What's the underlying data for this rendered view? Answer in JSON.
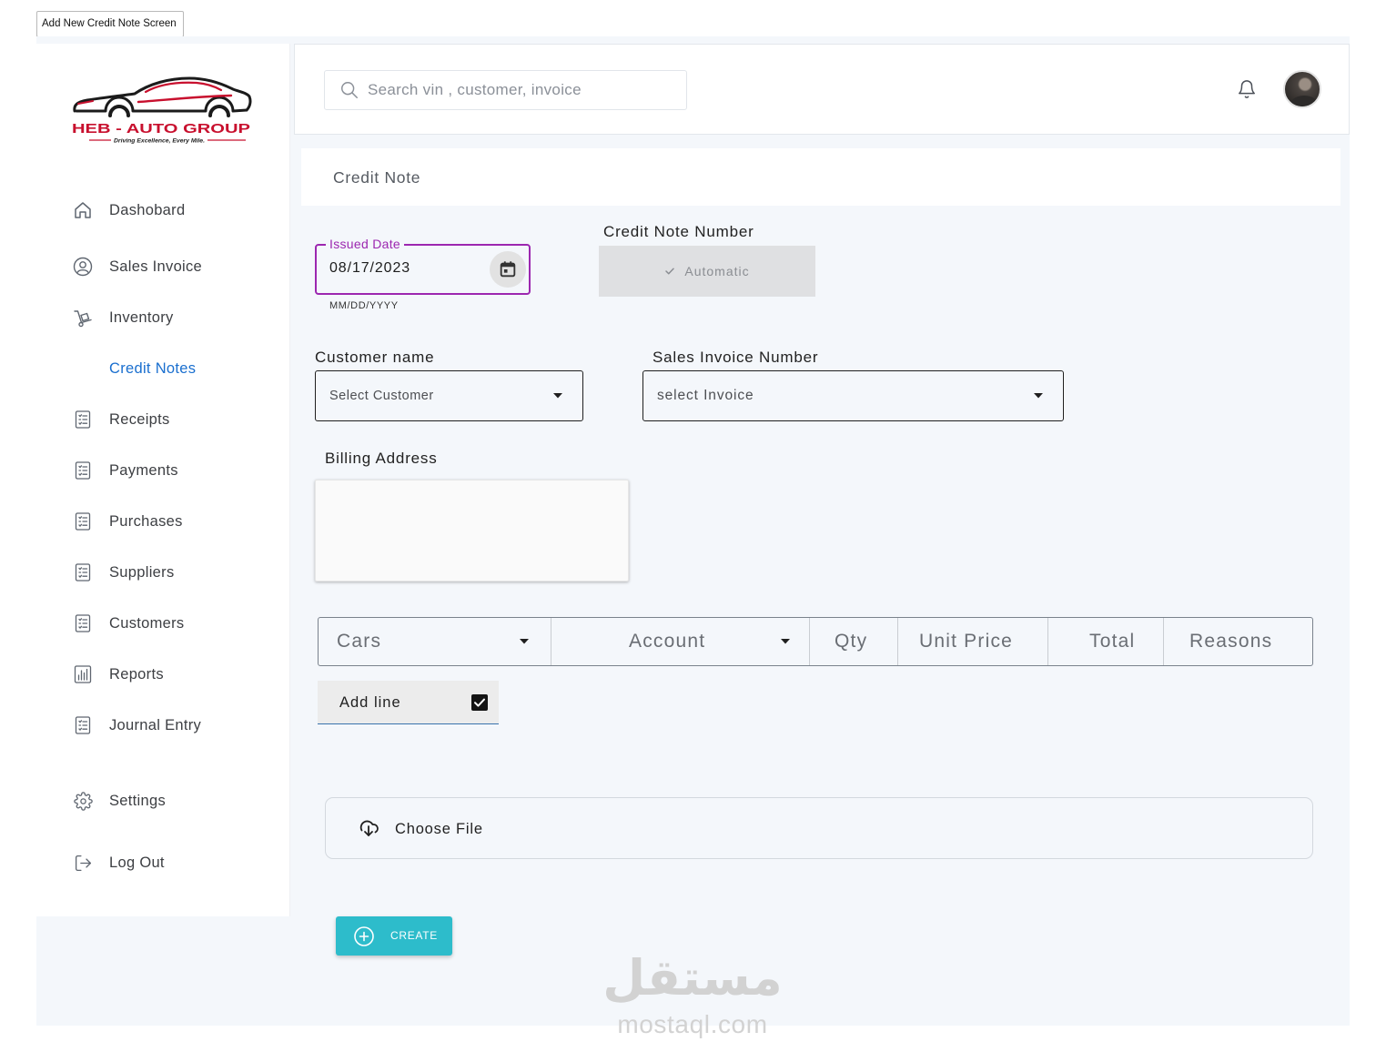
{
  "screen_label": "Add New Credit Note Screen",
  "logo": {
    "brand": "HEB - AUTO GROUP",
    "tagline": "Driving Excellence, Every Mile."
  },
  "sidebar": {
    "items": [
      {
        "label": "Dashobard",
        "icon": "home-icon"
      },
      {
        "label": "Sales Invoice",
        "icon": "user-circle-icon"
      },
      {
        "label": "Inventory",
        "icon": "hand-truck-icon"
      },
      {
        "label": "Credit Notes",
        "active": true
      },
      {
        "label": "Receipts",
        "icon": "list-document-icon"
      },
      {
        "label": "Payments",
        "icon": "list-document-icon"
      },
      {
        "label": "Purchases",
        "icon": "list-document-icon"
      },
      {
        "label": "Suppliers",
        "icon": "list-document-icon"
      },
      {
        "label": "Customers",
        "icon": "list-document-icon"
      },
      {
        "label": "Reports",
        "icon": "bar-chart-document-icon"
      },
      {
        "label": "Journal Entry",
        "icon": "list-document-icon"
      }
    ],
    "footer_items": [
      {
        "label": "Settings",
        "icon": "gear-icon"
      },
      {
        "label": "Log Out",
        "icon": "logout-icon"
      }
    ]
  },
  "header": {
    "search_placeholder": "Search vin , customer, invoice",
    "search_icon": "search-icon",
    "notification_icon": "bell-icon",
    "avatar_icon": "user-avatar"
  },
  "page_title": "Credit Note",
  "form": {
    "issued_date": {
      "label": "Issued Date",
      "value": "08/17/2023",
      "helper": "MM/DD/YYYY",
      "icon": "calendar-icon"
    },
    "credit_note_number": {
      "label": "Credit Note Number",
      "value": "Automatic",
      "icon": "check-icon"
    },
    "customer_name": {
      "label": "Customer name",
      "placeholder": "Select Customer"
    },
    "sales_invoice_number": {
      "label": "Sales Invoice Number",
      "placeholder": "select Invoice"
    },
    "billing_address": {
      "label": "Billing Address",
      "value": ""
    }
  },
  "lines_table": {
    "columns": [
      {
        "label": "Cars",
        "dropdown": true
      },
      {
        "label": "Account",
        "dropdown": true
      },
      {
        "label": "Qty"
      },
      {
        "label": "Unit Price"
      },
      {
        "label": "Total"
      },
      {
        "label": "Reasons"
      }
    ]
  },
  "add_line": {
    "label": "Add line",
    "checked": true
  },
  "file_upload": {
    "label": "Choose File",
    "icon": "cloud-download-icon"
  },
  "create_button": {
    "label": "CREATE",
    "icon": "plus-circle-icon"
  },
  "watermark": {
    "arabic": "مستقل",
    "latin": "mostaql.com"
  },
  "colors": {
    "active_nav": "#1a6fcf",
    "date_field_accent": "#9c27b0",
    "create_button": "#2dbccb",
    "brand_red": "#c8102e",
    "content_background": "#f4f7fb"
  }
}
